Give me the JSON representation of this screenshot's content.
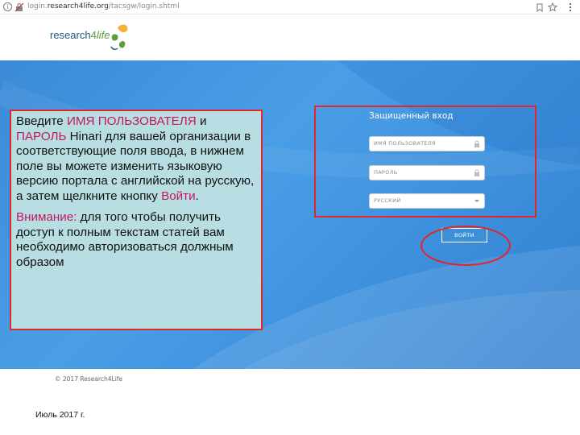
{
  "browser": {
    "url_prefix": "login.",
    "url_domain": "research4life.org",
    "url_path": "/tacsgw/login.shtml"
  },
  "logo": {
    "part1": "research",
    "part2": "4",
    "part3": "life"
  },
  "instructions": {
    "p1_a": "Введите ",
    "p1_user": "ИМЯ ПОЛЬЗОВАТЕЛЯ",
    "p1_b": " и ",
    "p1_pass": "ПАРОЛЬ",
    "p1_c": " Hinari для вашей организации в соответствующие поля ввода, в нижнем поле вы можете изменить языковую версию портала с английской на русскую, а затем щелкните кнопку ",
    "p1_login": "Войти",
    "p1_d": ".",
    "p2_label": "Внимание:",
    "p2_text": " для того чтобы получить доступ к полным текстам статей вам необходимо авторизоваться должным образом"
  },
  "login": {
    "title": "Защищенный вход",
    "username_placeholder": "ИМЯ ПОЛЬЗОВАТЕЛЯ",
    "password_placeholder": "ПАРОЛЬ",
    "language_value": "РУССКИЙ",
    "button_label": "ВОЙТИ"
  },
  "footer": {
    "copyright": "© 2017 Research4Life"
  },
  "slide": {
    "date": "Июль 2017 г."
  },
  "colors": {
    "highlight": "#c2185b",
    "frame_red": "#e2262a",
    "hero_blue": "#3d8fdc",
    "note_bg": "#b8dee3"
  }
}
